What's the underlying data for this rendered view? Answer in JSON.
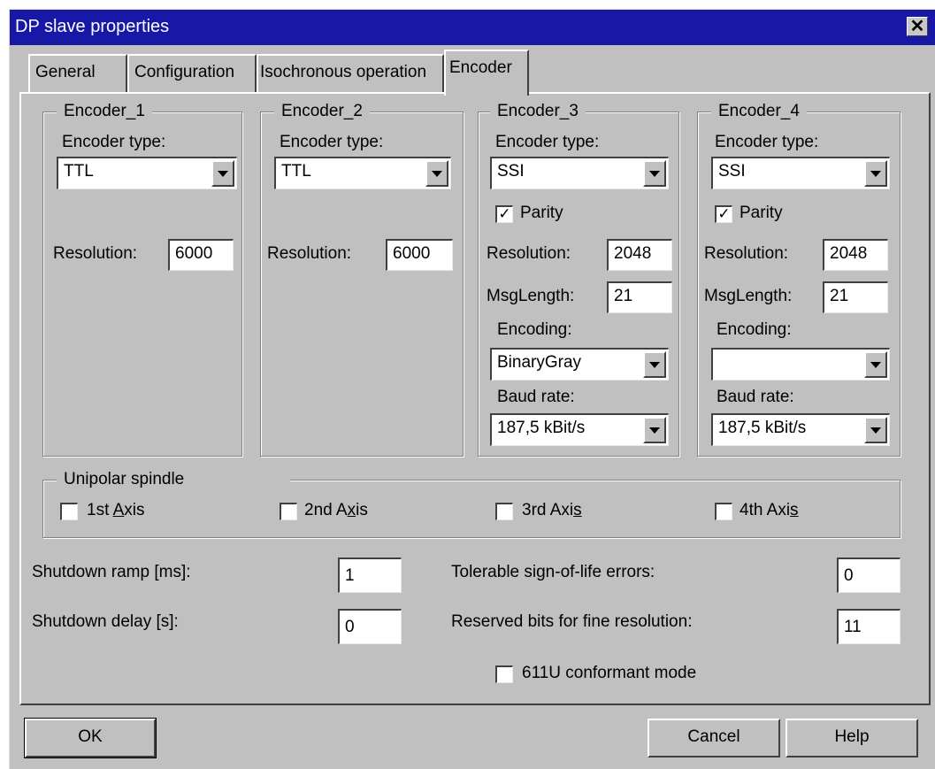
{
  "window": {
    "title": "DP slave properties"
  },
  "tabs": [
    "General",
    "Configuration",
    "Isochronous operation",
    "Encoder"
  ],
  "active_tab": "Encoder",
  "encoders": [
    {
      "name": "Encoder_1",
      "type_label": "Encoder type:",
      "type": "TTL",
      "resolution_label": "Resolution:",
      "resolution": "6000"
    },
    {
      "name": "Encoder_2",
      "type_label": "Encoder type:",
      "type": "TTL",
      "resolution_label": "Resolution:",
      "resolution": "6000"
    },
    {
      "name": "Encoder_3",
      "type_label": "Encoder type:",
      "type": "SSI",
      "parity_label": "Parity",
      "parity_checked": true,
      "resolution_label": "Resolution:",
      "resolution": "2048",
      "msglength_label": "MsgLength:",
      "msglength": "21",
      "encoding_label": "Encoding:",
      "encoding": "BinaryGray",
      "baud_label": "Baud rate:",
      "baud": "187,5 kBit/s"
    },
    {
      "name": "Encoder_4",
      "type_label": "Encoder type:",
      "type": "SSI",
      "parity_label": "Parity",
      "parity_checked": true,
      "resolution_label": "Resolution:",
      "resolution": "2048",
      "msglength_label": "MsgLength:",
      "msglength": "21",
      "encoding_label": "Encoding:",
      "encoding": "",
      "baud_label": "Baud rate:",
      "baud": "187,5 kBit/s"
    }
  ],
  "unipolar": {
    "title": "Unipolar spindle",
    "axes": [
      {
        "pre": "1st ",
        "ul": "A",
        "post": "xis",
        "checked": false
      },
      {
        "pre": "2nd A",
        "ul": "x",
        "post": "is",
        "checked": false
      },
      {
        "pre": "3rd Axi",
        "ul": "s",
        "post": "",
        "checked": false
      },
      {
        "pre": "4th Axi",
        "ul": "s",
        "post": "",
        "checked": false
      }
    ]
  },
  "settings": {
    "shutdown_ramp_label": "Shutdown ramp [ms]:",
    "shutdown_ramp": "1",
    "shutdown_delay_label": "Shutdown delay [s]:",
    "shutdown_delay": "0",
    "tolerable_label": "Tolerable sign-of-life errors:",
    "tolerable": "0",
    "reserved_label": "Reserved bits for fine resolution:",
    "reserved": "11",
    "conformant_label": "611U conformant mode",
    "conformant_checked": false
  },
  "buttons": {
    "ok": "OK",
    "cancel": "Cancel",
    "help": "Help"
  }
}
